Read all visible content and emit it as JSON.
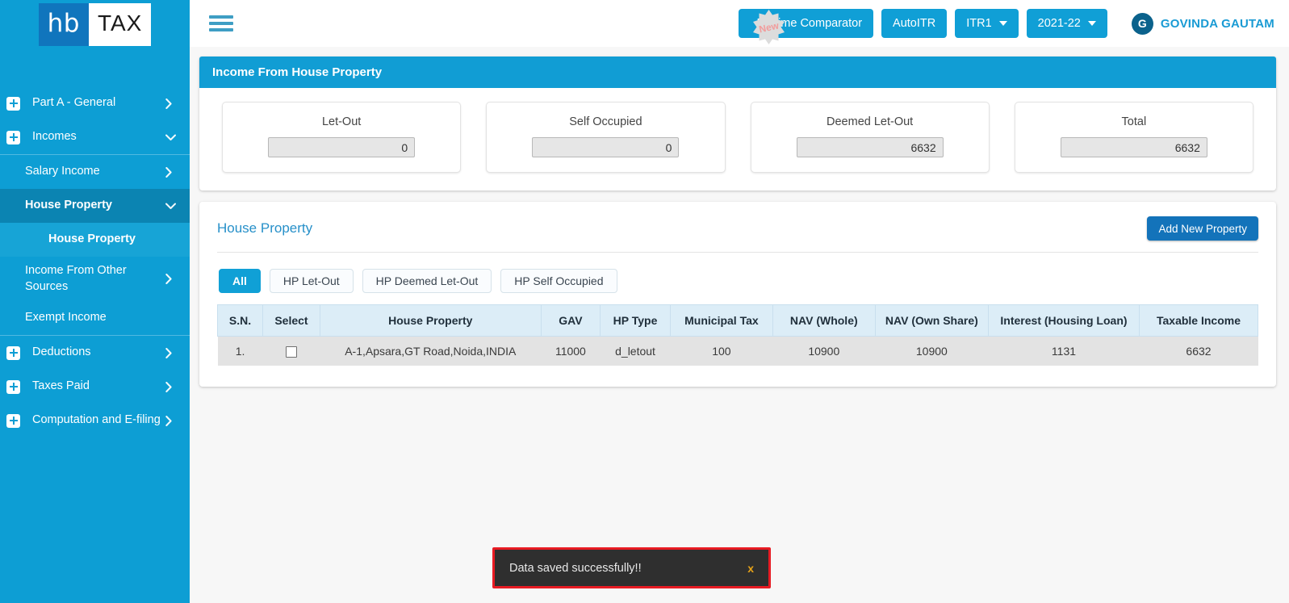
{
  "brand": {
    "logo_primary": "hb",
    "logo_secondary": "TAX"
  },
  "colors": {
    "sidebar_bg": "#0d9ed4",
    "sidebar_active": "#0b84b2",
    "accent": "#109fd6",
    "add_button": "#1373ba",
    "table_header": "#dcedf7",
    "toast_border": "#e81b23",
    "toast_bg": "#2f2f2f",
    "toast_close": "#e8a317",
    "link": "#2790c9"
  },
  "sidebar": {
    "items": [
      {
        "label": "Part A - General",
        "level": 1,
        "icon": "plus-square-icon",
        "chevron": "right",
        "state": "normal"
      },
      {
        "label": "Incomes",
        "level": 1,
        "icon": "plus-square-icon",
        "chevron": "down",
        "state": "normal"
      },
      {
        "label": "Salary Income",
        "level": 2,
        "icon": "",
        "chevron": "right",
        "state": "normal"
      },
      {
        "label": "House Property",
        "level": 2,
        "icon": "",
        "chevron": "down",
        "state": "active-dark"
      },
      {
        "label": "House Property",
        "level": 3,
        "icon": "",
        "chevron": "",
        "state": "sub-active"
      },
      {
        "label": "Income From Other Sources",
        "level": 2,
        "icon": "",
        "chevron": "right",
        "state": "normal"
      },
      {
        "label": "Exempt Income",
        "level": 2,
        "icon": "",
        "chevron": "",
        "state": "normal"
      },
      {
        "label": "Deductions",
        "level": 1,
        "icon": "plus-square-icon",
        "chevron": "right",
        "state": "normal"
      },
      {
        "label": "Taxes Paid",
        "level": 1,
        "icon": "plus-square-icon",
        "chevron": "right",
        "state": "normal"
      },
      {
        "label": "Computation and E-filing",
        "level": 1,
        "icon": "plus-square-icon",
        "chevron": "right",
        "state": "normal"
      }
    ]
  },
  "topbar": {
    "menu_icon": "hamburger-icon",
    "new_badge": "New",
    "regime_comparator": "Regime Comparator",
    "auto_itr": "AutoITR",
    "itr_select": "ITR1",
    "year_select": "2021-22",
    "avatar_initial": "G",
    "user_name": "GOVINDA GAUTAM"
  },
  "income_panel": {
    "title": "Income From House Property",
    "boxes": [
      {
        "label": "Let-Out",
        "value": "0"
      },
      {
        "label": "Self Occupied",
        "value": "0"
      },
      {
        "label": "Deemed Let-Out",
        "value": "6632"
      },
      {
        "label": "Total",
        "value": "6632"
      }
    ]
  },
  "house_property": {
    "title": "House Property",
    "add_button": "Add New Property",
    "tabs": [
      {
        "label": "All",
        "active": true
      },
      {
        "label": "HP Let-Out",
        "active": false
      },
      {
        "label": "HP Deemed Let-Out",
        "active": false
      },
      {
        "label": "HP Self Occupied",
        "active": false
      }
    ],
    "table": {
      "columns": [
        "S.N.",
        "Select",
        "House Property",
        "GAV",
        "HP Type",
        "Municipal Tax",
        "NAV (Whole)",
        "NAV (Own Share)",
        "Interest (Housing Loan)",
        "Taxable Income"
      ],
      "rows": [
        {
          "sn": "1.",
          "select": "",
          "property": "A-1,Apsara,GT Road,Noida,INDIA",
          "gav": "11000",
          "hp_type": "d_letout",
          "municipal_tax": "100",
          "nav_whole": "10900",
          "nav_own_share": "10900",
          "interest_housing_loan": "1131",
          "taxable_income": "6632"
        }
      ]
    }
  },
  "toast": {
    "message": "Data saved successfully!!",
    "close_label": "x"
  }
}
